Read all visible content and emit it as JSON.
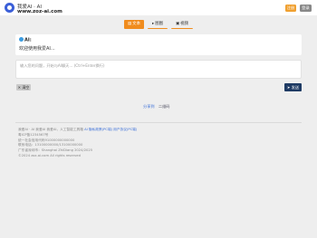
{
  "header": {
    "site_name": "我爱AI · AI",
    "site_url": "www.zoz-ai.com",
    "register_label": "注册",
    "login_label": "登录"
  },
  "tabs": [
    {
      "label": "文本",
      "icon": "text-icon",
      "active": true
    },
    {
      "label": "图图",
      "icon": "image-icon",
      "active": false
    },
    {
      "label": "视频",
      "icon": "video-icon",
      "active": false
    }
  ],
  "ai_card": {
    "label": "AI:",
    "welcome": "欢迎使用我爱AI..."
  },
  "input": {
    "placeholder": "输入您的问题，开始与AI聊天... (Ctrl+Enter换行)"
  },
  "clear_label": "清空",
  "send_label": "发送",
  "share": {
    "first": "分享到",
    "second": "二维码"
  },
  "footer": {
    "line1_text": "我爱AI · AI 我爱AI  我爱AI，人工智能工具箱 ",
    "line1_links": "AI 隐私政策(PC端) 用户协议(PC端)",
    "line2": "粤ICP备1234567号",
    "line3": "统一社会信用代码91000000000000",
    "line4": "联系电话：13100000000/13100000000",
    "line5": "广东省深圳市：Shanghai ZhiDiang 2024/2025",
    "line6": "©2024 zoz-ai.com All rights reserved"
  },
  "colors": {
    "accent": "#f08c1e",
    "send": "#1f3b64",
    "logo": "#3b5fd8"
  }
}
